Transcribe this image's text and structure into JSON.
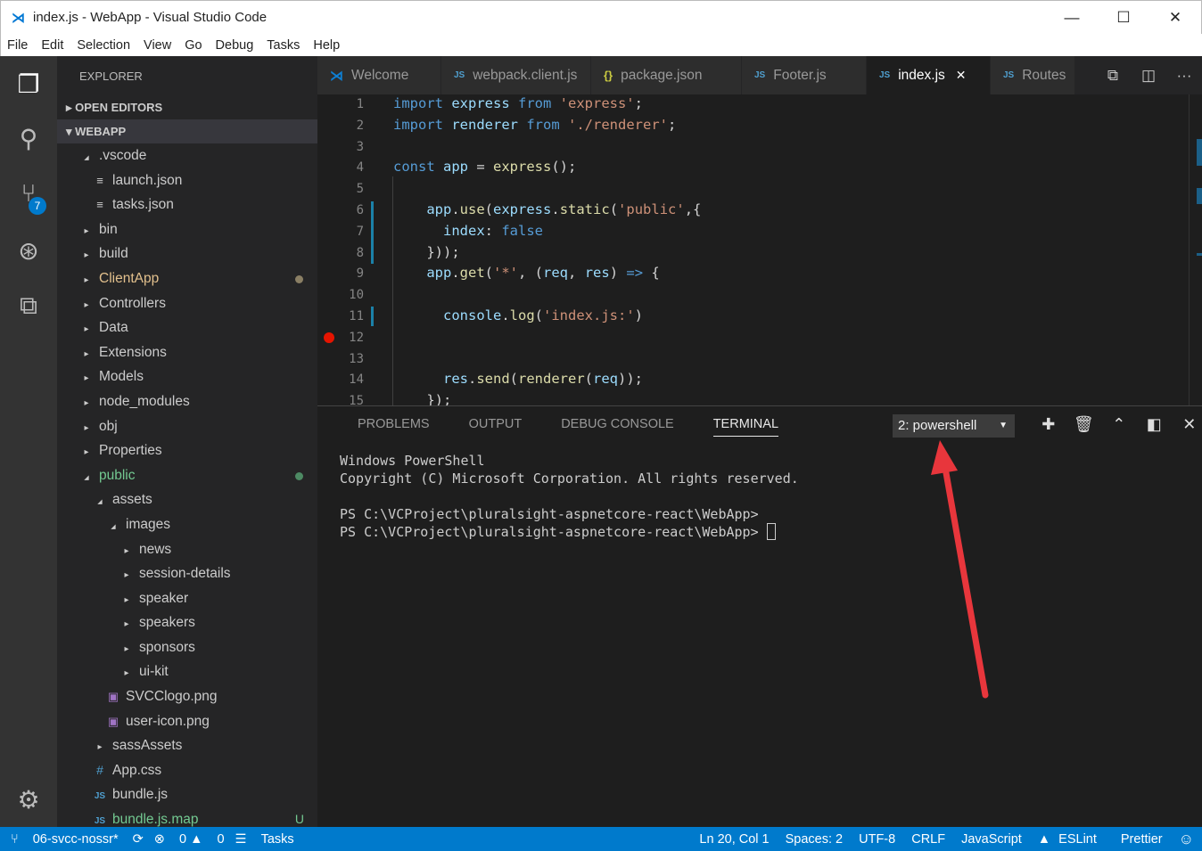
{
  "window": {
    "title": "index.js - WebApp - Visual Studio Code",
    "minimize": "—",
    "maximize": "☐",
    "close": "✕"
  },
  "menu": [
    "File",
    "Edit",
    "Selection",
    "View",
    "Go",
    "Debug",
    "Tasks",
    "Help"
  ],
  "activity": {
    "scm_badge": "7"
  },
  "explorer": {
    "title": "EXPLORER",
    "open_editors": "OPEN EDITORS",
    "project": "WEBAPP",
    "items": [
      {
        "label": ".vscode",
        "depth": 1,
        "icon": "chevron-down"
      },
      {
        "label": "launch.json",
        "depth": 2,
        "icon": "file"
      },
      {
        "label": "tasks.json",
        "depth": 2,
        "icon": "file"
      },
      {
        "label": "bin",
        "depth": 1,
        "icon": "chevron-right"
      },
      {
        "label": "build",
        "depth": 1,
        "icon": "chevron-right"
      },
      {
        "label": "ClientApp",
        "depth": 1,
        "icon": "chevron-right",
        "color": "#e2c08d",
        "dot": "#8a7f64"
      },
      {
        "label": "Controllers",
        "depth": 1,
        "icon": "chevron-right"
      },
      {
        "label": "Data",
        "depth": 1,
        "icon": "chevron-right"
      },
      {
        "label": "Extensions",
        "depth": 1,
        "icon": "chevron-right"
      },
      {
        "label": "Models",
        "depth": 1,
        "icon": "chevron-right"
      },
      {
        "label": "node_modules",
        "depth": 1,
        "icon": "chevron-right"
      },
      {
        "label": "obj",
        "depth": 1,
        "icon": "chevron-right"
      },
      {
        "label": "Properties",
        "depth": 1,
        "icon": "chevron-right"
      },
      {
        "label": "public",
        "depth": 1,
        "icon": "chevron-down",
        "color": "#73c991",
        "dot": "#4d8a63"
      },
      {
        "label": "assets",
        "depth": 2,
        "icon": "chevron-down"
      },
      {
        "label": "images",
        "depth": 3,
        "icon": "chevron-down"
      },
      {
        "label": "news",
        "depth": 4,
        "icon": "chevron-right"
      },
      {
        "label": "session-details",
        "depth": 4,
        "icon": "chevron-right"
      },
      {
        "label": "speaker",
        "depth": 4,
        "icon": "chevron-right"
      },
      {
        "label": "speakers",
        "depth": 4,
        "icon": "chevron-right"
      },
      {
        "label": "sponsors",
        "depth": 4,
        "icon": "chevron-right"
      },
      {
        "label": "ui-kit",
        "depth": 4,
        "icon": "chevron-right"
      },
      {
        "label": "SVCClogo.png",
        "depth": 3,
        "icon": "image"
      },
      {
        "label": "user-icon.png",
        "depth": 3,
        "icon": "image"
      },
      {
        "label": "sassAssets",
        "depth": 2,
        "icon": "chevron-right"
      },
      {
        "label": "App.css",
        "depth": 2,
        "icon": "hash"
      },
      {
        "label": "bundle.js",
        "depth": 2,
        "icon": "js"
      },
      {
        "label": "bundle.js.map",
        "depth": 2,
        "icon": "js",
        "color": "#73c991",
        "status": "U"
      }
    ]
  },
  "tabs": [
    {
      "label": "Welcome",
      "icon": "vs"
    },
    {
      "label": "webpack.client.js",
      "icon": "js"
    },
    {
      "label": "package.json",
      "icon": "json"
    },
    {
      "label": "Footer.js",
      "icon": "js"
    },
    {
      "label": "index.js",
      "icon": "js",
      "active": true
    },
    {
      "label": "Routes",
      "icon": "js"
    }
  ],
  "editor": {
    "lines": [
      [
        [
          "import ",
          "kw"
        ],
        [
          "express ",
          "var"
        ],
        [
          "from ",
          "kw"
        ],
        [
          "'express'",
          "str"
        ],
        [
          ";",
          "pl"
        ]
      ],
      [
        [
          "import ",
          "kw"
        ],
        [
          "renderer ",
          "var"
        ],
        [
          "from ",
          "kw"
        ],
        [
          "'./renderer'",
          "str"
        ],
        [
          ";",
          "pl"
        ]
      ],
      [],
      [
        [
          "const ",
          "kw"
        ],
        [
          "app ",
          "var"
        ],
        [
          "= ",
          "pl"
        ],
        [
          "express",
          "fn"
        ],
        [
          "();",
          "pl"
        ]
      ],
      [],
      [
        [
          "    app",
          "var"
        ],
        [
          ".",
          "pl"
        ],
        [
          "use",
          "fn"
        ],
        [
          "(",
          "pl"
        ],
        [
          "express",
          "var"
        ],
        [
          ".",
          "pl"
        ],
        [
          "static",
          "fn"
        ],
        [
          "(",
          "pl"
        ],
        [
          "'public'",
          "str"
        ],
        [
          ",{",
          "pl"
        ]
      ],
      [
        [
          "      index",
          "var"
        ],
        [
          ": ",
          "pl"
        ],
        [
          "false",
          "kw"
        ]
      ],
      [
        [
          "    }));",
          "pl"
        ]
      ],
      [
        [
          "    app",
          "var"
        ],
        [
          ".",
          "pl"
        ],
        [
          "get",
          "fn"
        ],
        [
          "(",
          "pl"
        ],
        [
          "'*'",
          "str"
        ],
        [
          ", (",
          "pl"
        ],
        [
          "req",
          "var"
        ],
        [
          ", ",
          "pl"
        ],
        [
          "res",
          "var"
        ],
        [
          ") ",
          "pl"
        ],
        [
          "=>",
          "kw"
        ],
        [
          " {",
          "pl"
        ]
      ],
      [],
      [
        [
          "      console",
          "var"
        ],
        [
          ".",
          "pl"
        ],
        [
          "log",
          "fn"
        ],
        [
          "(",
          "pl"
        ],
        [
          "'index.js:'",
          "str"
        ],
        [
          ")",
          "pl"
        ]
      ],
      [],
      [],
      [
        [
          "      res",
          "var"
        ],
        [
          ".",
          "pl"
        ],
        [
          "send",
          "fn"
        ],
        [
          "(",
          "pl"
        ],
        [
          "renderer",
          "fn"
        ],
        [
          "(",
          "pl"
        ],
        [
          "req",
          "var"
        ],
        [
          "));",
          "pl"
        ]
      ],
      [
        [
          "    });",
          "pl"
        ]
      ]
    ]
  },
  "panel": {
    "tabs": [
      "PROBLEMS",
      "OUTPUT",
      "DEBUG CONSOLE",
      "TERMINAL"
    ],
    "active_tab": "TERMINAL",
    "terminal_select": "2: powershell",
    "terminal_lines": [
      "Windows PowerShell",
      "Copyright (C) Microsoft Corporation. All rights reserved.",
      "",
      "PS C:\\VCProject\\pluralsight-aspnetcore-react\\WebApp>",
      "PS C:\\VCProject\\pluralsight-aspnetcore-react\\WebApp> "
    ]
  },
  "status": {
    "branch": "06-svcc-nossr*",
    "errors": "0",
    "warnings": "0",
    "tasks": "Tasks",
    "position": "Ln 20, Col 1",
    "spaces": "Spaces: 2",
    "encoding": "UTF-8",
    "eol": "CRLF",
    "language": "JavaScript",
    "eslint": "ESLint",
    "prettier": "Prettier"
  },
  "colors": {
    "accent": "#007acc",
    "annotation_arrow": "#e8363c",
    "breakpoint": "#e51400"
  }
}
